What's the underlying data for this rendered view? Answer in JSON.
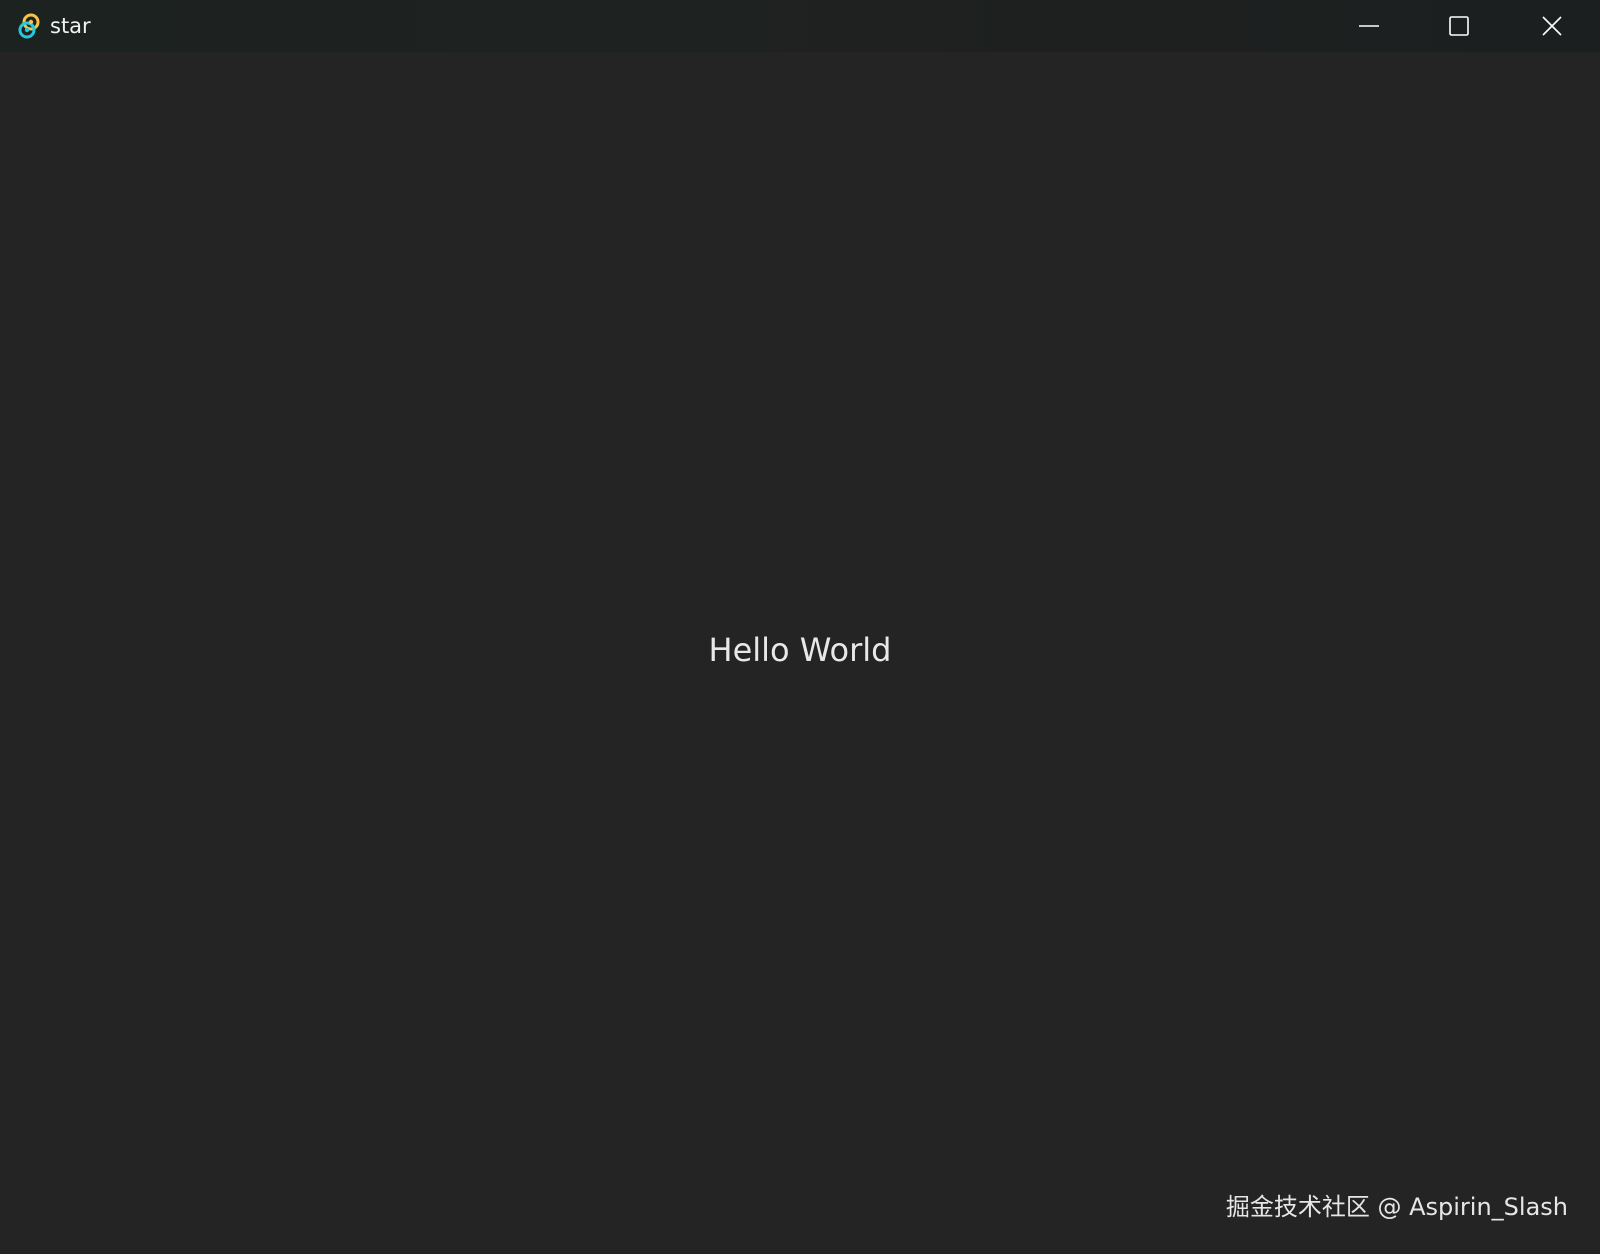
{
  "window": {
    "title": "star",
    "icon": "tauri-app-icon",
    "controls": {
      "minimize_icon": "minimize-icon",
      "maximize_icon": "maximize-icon",
      "close_icon": "close-icon"
    }
  },
  "main": {
    "text": "Hello World"
  },
  "watermark": {
    "text": "掘金技术社区 @ Aspirin_Slash"
  },
  "colors": {
    "background": "#242424",
    "titlebar": "#1e2220",
    "text": "#e8e8e8",
    "icon_yellow": "#f5c24a",
    "icon_cyan": "#24c8db"
  }
}
